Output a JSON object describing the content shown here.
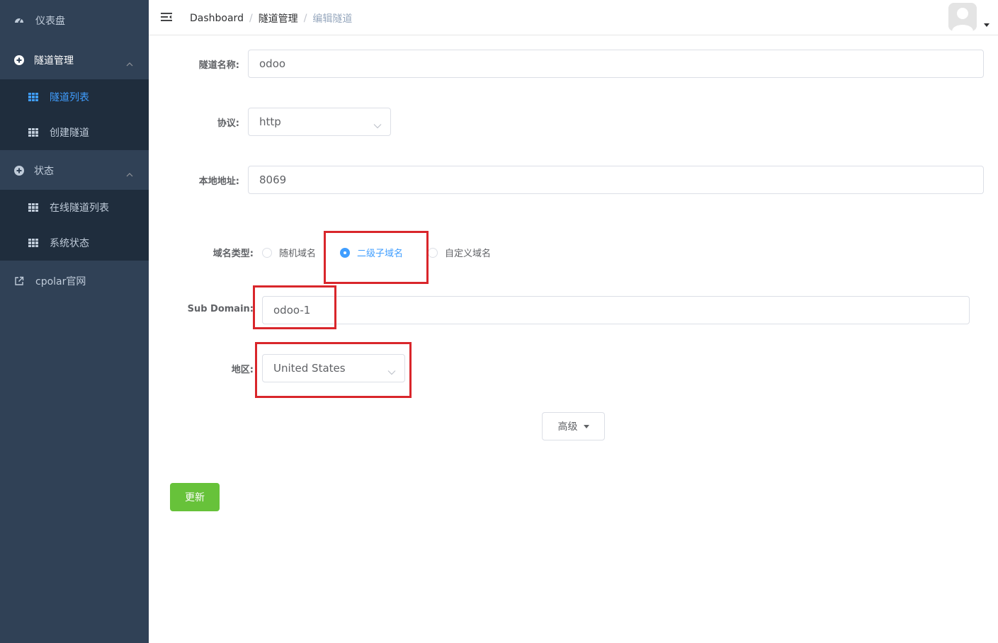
{
  "sidebar": {
    "items": [
      {
        "label": "仪表盘",
        "icon": "dashboard-icon"
      },
      {
        "label": "隧道管理",
        "icon": "plus-circle-icon",
        "expanded": true,
        "children": [
          {
            "label": "隧道列表",
            "icon": "table-icon",
            "active": true
          },
          {
            "label": "创建隧道",
            "icon": "table-icon"
          }
        ]
      },
      {
        "label": "状态",
        "icon": "plus-circle-icon",
        "expanded": true,
        "children": [
          {
            "label": "在线隧道列表",
            "icon": "table-icon"
          },
          {
            "label": "系统状态",
            "icon": "table-icon"
          }
        ]
      },
      {
        "label": "cpolar官网",
        "icon": "external-link-icon"
      }
    ]
  },
  "header": {
    "breadcrumb": [
      "Dashboard",
      "隧道管理",
      "编辑隧道"
    ]
  },
  "form": {
    "name_label": "隧道名称:",
    "name_value": "odoo",
    "protocol_label": "协议:",
    "protocol_value": "http",
    "local_label": "本地地址:",
    "local_value": "8069",
    "domain_type_label": "域名类型:",
    "domain_types": [
      "随机域名",
      "二级子域名",
      "自定义域名"
    ],
    "domain_type_selected": "二级子域名",
    "subdomain_label": "Sub Domain:",
    "subdomain_value": "odoo-1",
    "region_label": "地区:",
    "region_value": "United States",
    "advanced_label": "高级",
    "update_label": "更新"
  },
  "colors": {
    "sidebar_bg": "#304156",
    "submenu_bg": "#1f2d3d",
    "accent": "#409eff",
    "update_button": "#67c23a",
    "highlight_box": "#d9262b"
  }
}
